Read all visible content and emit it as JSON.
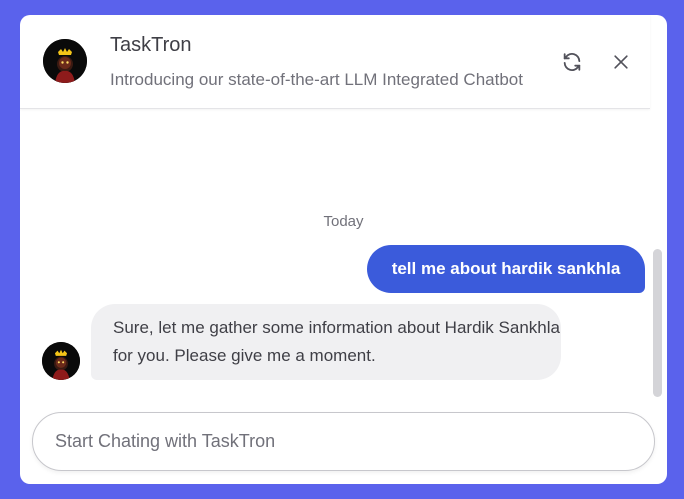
{
  "header": {
    "title": "TaskTron",
    "description": "Introducing our state-of-the-art LLM Integrated Chatbot",
    "refresh_icon": "refresh-icon",
    "close_icon": "close-icon"
  },
  "conversation": {
    "date_separator": "Today",
    "messages": [
      {
        "role": "user",
        "text": "tell me about hardik sankhla"
      },
      {
        "role": "bot",
        "text": "Sure, let me gather some information about Hardik Sankhla for you. Please give me a moment."
      }
    ]
  },
  "composer": {
    "placeholder": "Start Chating with TaskTron",
    "value": ""
  },
  "colors": {
    "page_background": "#5a62ec",
    "user_bubble": "#3b5bdb",
    "bot_bubble": "#f0f0f2",
    "text_primary": "#3f3f46",
    "text_muted": "#71717a"
  }
}
